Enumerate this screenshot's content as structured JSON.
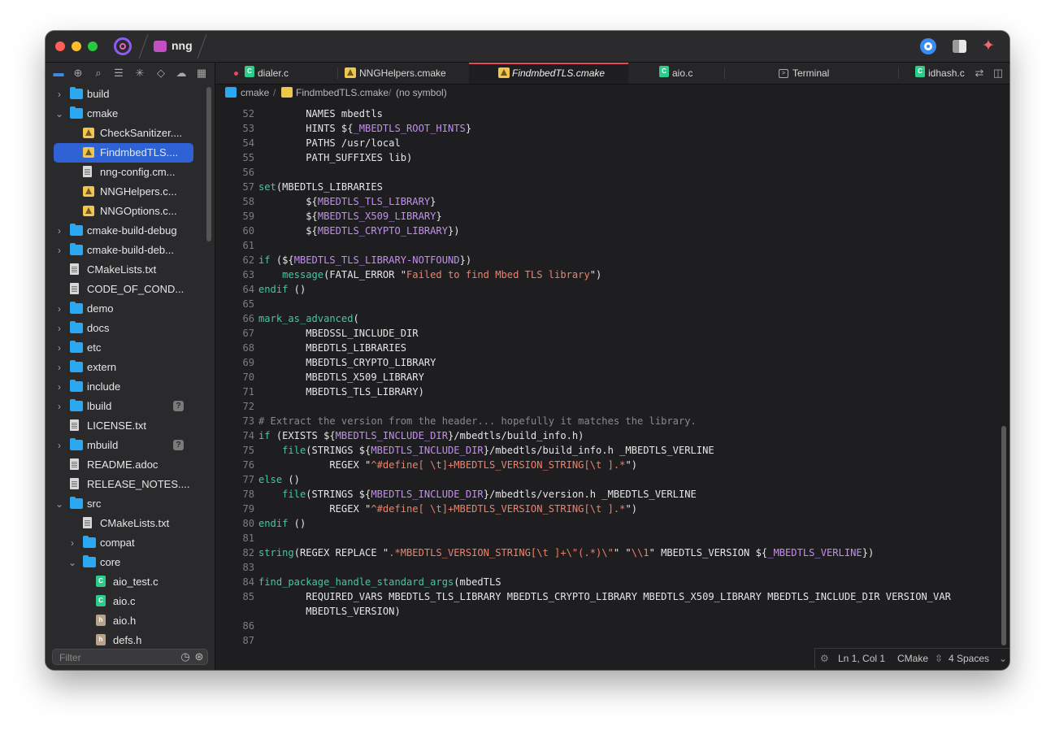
{
  "window": {
    "project_name": "nng",
    "titlebar_icons": [
      "circle-target-icon",
      "layout-icon",
      "sparkle-icon"
    ]
  },
  "sidebar": {
    "toolbar_icons": [
      "folder-icon",
      "globe-icon",
      "search-icon",
      "outline-icon",
      "asterisk-icon",
      "git-icon",
      "cloud-icon",
      "grid-icon"
    ],
    "tree": [
      {
        "label": "build",
        "type": "folder",
        "depth": 0,
        "expanded": false
      },
      {
        "label": "cmake",
        "type": "folder",
        "depth": 0,
        "expanded": true
      },
      {
        "label": "CheckSanitizer....",
        "type": "cmake",
        "depth": 1
      },
      {
        "label": "FindmbedTLS....",
        "type": "cmake",
        "depth": 1,
        "selected": true
      },
      {
        "label": "nng-config.cm...",
        "type": "doc",
        "depth": 1
      },
      {
        "label": "NNGHelpers.c...",
        "type": "cmake",
        "depth": 1
      },
      {
        "label": "NNGOptions.c...",
        "type": "cmake",
        "depth": 1
      },
      {
        "label": "cmake-build-debug",
        "type": "folder",
        "depth": 0,
        "expanded": false
      },
      {
        "label": "cmake-build-deb...",
        "type": "folder",
        "depth": 0,
        "expanded": false
      },
      {
        "label": "CMakeLists.txt",
        "type": "doc",
        "depth": 0
      },
      {
        "label": "CODE_OF_COND...",
        "type": "doc",
        "depth": 0
      },
      {
        "label": "demo",
        "type": "folder",
        "depth": 0,
        "expanded": false
      },
      {
        "label": "docs",
        "type": "folder",
        "depth": 0,
        "expanded": false
      },
      {
        "label": "etc",
        "type": "folder",
        "depth": 0,
        "expanded": false
      },
      {
        "label": "extern",
        "type": "folder",
        "depth": 0,
        "expanded": false
      },
      {
        "label": "include",
        "type": "folder",
        "depth": 0,
        "expanded": false
      },
      {
        "label": "lbuild",
        "type": "folder",
        "depth": 0,
        "expanded": false,
        "badge": "?"
      },
      {
        "label": "LICENSE.txt",
        "type": "doc",
        "depth": 0
      },
      {
        "label": "mbuild",
        "type": "folder",
        "depth": 0,
        "expanded": false,
        "badge": "?"
      },
      {
        "label": "README.adoc",
        "type": "doc",
        "depth": 0
      },
      {
        "label": "RELEASE_NOTES....",
        "type": "doc",
        "depth": 0
      },
      {
        "label": "src",
        "type": "folder",
        "depth": 0,
        "expanded": true
      },
      {
        "label": "CMakeLists.txt",
        "type": "doc",
        "depth": 1
      },
      {
        "label": "compat",
        "type": "folder",
        "depth": 1,
        "expanded": false
      },
      {
        "label": "core",
        "type": "folder",
        "depth": 1,
        "expanded": true
      },
      {
        "label": "aio_test.c",
        "type": "c",
        "depth": 2
      },
      {
        "label": "aio.c",
        "type": "c",
        "depth": 2
      },
      {
        "label": "aio.h",
        "type": "h",
        "depth": 2
      },
      {
        "label": "defs.h",
        "type": "h",
        "depth": 2
      }
    ],
    "filter_placeholder": "Filter"
  },
  "tabs": [
    {
      "label": "dialer.c",
      "icon": "c-file-icon",
      "modified": true,
      "active": false
    },
    {
      "label": "NNGHelpers.cmake",
      "icon": "cmake-file-icon",
      "active": false
    },
    {
      "label": "FindmbedTLS.cmake",
      "icon": "cmake-file-icon",
      "active": true
    },
    {
      "label": "aio.c",
      "icon": "c-file-icon",
      "active": false
    },
    {
      "label": "Terminal",
      "icon": "terminal-icon",
      "active": false
    },
    {
      "label": "idhash.c",
      "icon": "c-file-icon",
      "active": false
    }
  ],
  "breadcrumb": {
    "folder": "cmake",
    "file": "FindmbedTLS.cmake",
    "symbol": "(no symbol)"
  },
  "editor": {
    "lines": [
      {
        "n": "52",
        "code": [
          [
            "        NAMES mbedtls",
            ""
          ]
        ]
      },
      {
        "n": "53",
        "code": [
          [
            "        HINTS ${",
            ""
          ],
          [
            "_MBEDTLS_ROOT_HINTS",
            "p"
          ],
          [
            "}",
            ""
          ]
        ]
      },
      {
        "n": "54",
        "code": [
          [
            "        PATHS /usr/local",
            ""
          ]
        ]
      },
      {
        "n": "55",
        "code": [
          [
            "        PATH_SUFFIXES lib)",
            ""
          ]
        ]
      },
      {
        "n": "56",
        "code": []
      },
      {
        "n": "57",
        "code": [
          [
            "set",
            "g"
          ],
          [
            "(MBEDTLS_LIBRARIES",
            ""
          ]
        ]
      },
      {
        "n": "58",
        "code": [
          [
            "        ${",
            ""
          ],
          [
            "MBEDTLS_TLS_LIBRARY",
            "p"
          ],
          [
            "}",
            ""
          ]
        ]
      },
      {
        "n": "59",
        "code": [
          [
            "        ${",
            ""
          ],
          [
            "MBEDTLS_X509_LIBRARY",
            "p"
          ],
          [
            "}",
            ""
          ]
        ]
      },
      {
        "n": "60",
        "code": [
          [
            "        ${",
            ""
          ],
          [
            "MBEDTLS_CRYPTO_LIBRARY",
            "p"
          ],
          [
            "})",
            ""
          ]
        ]
      },
      {
        "n": "61",
        "code": []
      },
      {
        "n": "62",
        "code": [
          [
            "if",
            "g"
          ],
          [
            " (${",
            ""
          ],
          [
            "MBEDTLS_TLS_LIBRARY-NOTFOUND",
            "p"
          ],
          [
            "})",
            ""
          ]
        ]
      },
      {
        "n": "63",
        "code": [
          [
            "    ",
            ""
          ],
          [
            "message",
            "g"
          ],
          [
            "(FATAL_ERROR \"",
            ""
          ],
          [
            "Failed to find Mbed TLS library",
            "s"
          ],
          [
            "\")",
            ""
          ]
        ]
      },
      {
        "n": "64",
        "code": [
          [
            "endif",
            "g"
          ],
          [
            " ()",
            ""
          ]
        ]
      },
      {
        "n": "65",
        "code": []
      },
      {
        "n": "66",
        "code": [
          [
            "mark_as_advanced",
            "g"
          ],
          [
            "(",
            ""
          ]
        ]
      },
      {
        "n": "67",
        "code": [
          [
            "        MBEDSSL_INCLUDE_DIR",
            ""
          ]
        ]
      },
      {
        "n": "68",
        "code": [
          [
            "        MBEDTLS_LIBRARIES",
            ""
          ]
        ]
      },
      {
        "n": "69",
        "code": [
          [
            "        MBEDTLS_CRYPTO_LIBRARY",
            ""
          ]
        ]
      },
      {
        "n": "70",
        "code": [
          [
            "        MBEDTLS_X509_LIBRARY",
            ""
          ]
        ]
      },
      {
        "n": "71",
        "code": [
          [
            "        MBEDTLS_TLS_LIBRARY)",
            ""
          ]
        ]
      },
      {
        "n": "72",
        "code": []
      },
      {
        "n": "73",
        "code": [
          [
            "# Extract the version from the header... hopefully it matches the library.",
            "c"
          ]
        ]
      },
      {
        "n": "74",
        "code": [
          [
            "if",
            "g"
          ],
          [
            " (EXISTS ${",
            ""
          ],
          [
            "MBEDTLS_INCLUDE_DIR",
            "p"
          ],
          [
            "}/mbedtls/build_info.h)",
            ""
          ]
        ]
      },
      {
        "n": "75",
        "code": [
          [
            "    ",
            ""
          ],
          [
            "file",
            "g"
          ],
          [
            "(STRINGS ${",
            ""
          ],
          [
            "MBEDTLS_INCLUDE_DIR",
            "p"
          ],
          [
            "}/mbedtls/build_info.h _MBEDTLS_VERLINE",
            ""
          ]
        ]
      },
      {
        "n": "76",
        "code": [
          [
            "            REGEX \"",
            ""
          ],
          [
            "^#define[ \\t]+MBEDTLS_VERSION_STRING[\\t ].*",
            "s"
          ],
          [
            "\")",
            ""
          ]
        ]
      },
      {
        "n": "77",
        "code": [
          [
            "else",
            "g"
          ],
          [
            " ()",
            ""
          ]
        ]
      },
      {
        "n": "78",
        "code": [
          [
            "    ",
            ""
          ],
          [
            "file",
            "g"
          ],
          [
            "(STRINGS ${",
            ""
          ],
          [
            "MBEDTLS_INCLUDE_DIR",
            "p"
          ],
          [
            "}/mbedtls/version.h _MBEDTLS_VERLINE",
            ""
          ]
        ]
      },
      {
        "n": "79",
        "code": [
          [
            "            REGEX \"",
            ""
          ],
          [
            "^#define[ \\t]+MBEDTLS_VERSION_STRING[\\t ].*",
            "s"
          ],
          [
            "\")",
            ""
          ]
        ]
      },
      {
        "n": "80",
        "code": [
          [
            "endif",
            "g"
          ],
          [
            " ()",
            ""
          ]
        ]
      },
      {
        "n": "81",
        "code": []
      },
      {
        "n": "82",
        "code": [
          [
            "string",
            "g"
          ],
          [
            "(REGEX REPLACE \"",
            ""
          ],
          [
            ".*MBEDTLS_VERSION_STRING[\\t ]+\\\"(.*)\\\"",
            "s"
          ],
          [
            "\" \"",
            ""
          ],
          [
            "\\\\1",
            "s"
          ],
          [
            "\" MBEDTLS_VERSION ${",
            ""
          ],
          [
            "_MBEDTLS_VERLINE",
            "p"
          ],
          [
            "})",
            ""
          ]
        ]
      },
      {
        "n": "83",
        "code": []
      },
      {
        "n": "84",
        "code": [
          [
            "find_package_handle_standard_args",
            "g"
          ],
          [
            "(mbedTLS",
            ""
          ]
        ]
      },
      {
        "n": "85",
        "code": [
          [
            "        REQUIRED_VARS MBEDTLS_TLS_LIBRARY MBEDTLS_CRYPTO_LIBRARY MBEDTLS_X509_LIBRARY MBEDTLS_INCLUDE_DIR VERSION_VAR",
            ""
          ]
        ]
      },
      {
        "n": "",
        "code": [
          [
            "        MBEDTLS_VERSION)",
            ""
          ]
        ]
      },
      {
        "n": "86",
        "code": []
      },
      {
        "n": "87",
        "code": []
      }
    ]
  },
  "status": {
    "position": "Ln 1, Col 1",
    "language": "CMake",
    "indent": "4 Spaces"
  }
}
